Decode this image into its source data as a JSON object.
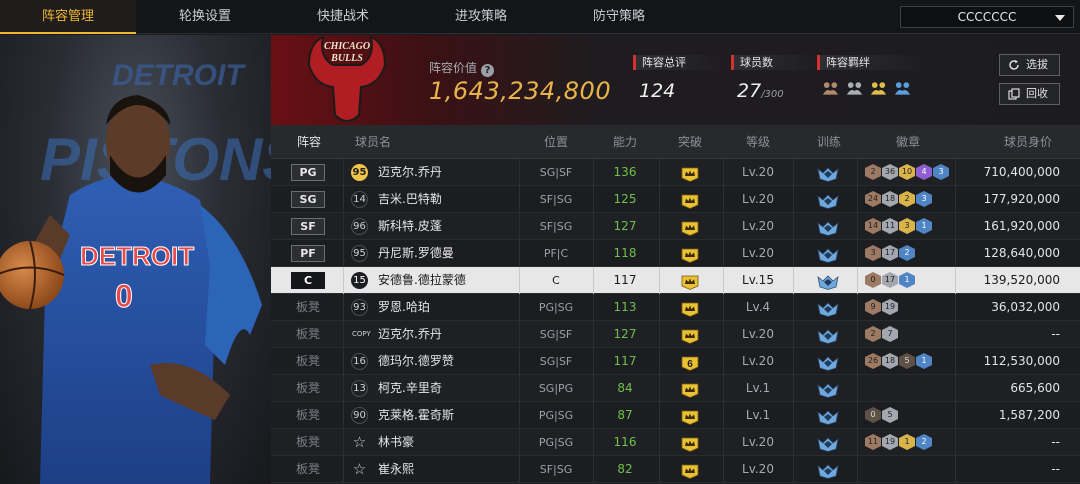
{
  "nav": {
    "tabs": [
      "阵容管理",
      "轮换设置",
      "快捷战术",
      "进攻策略",
      "防守策略"
    ],
    "team_select": "CCCCCCC"
  },
  "art": {
    "backdrop_lines": [
      "DETROIT",
      "PISTONS"
    ],
    "jersey_city": "DETROIT",
    "jersey_number": "0",
    "team_logo_lines": [
      "CHICAGO",
      "BULLS"
    ]
  },
  "header": {
    "value_label": "阵容价值",
    "help_icon": "?",
    "value": "1,643,234,800",
    "overall_label": "阵容总评",
    "overall": "124",
    "players_label": "球员数",
    "players": "27",
    "players_max": "/300",
    "chem_label": "阵容羁绊",
    "chem_icons": [
      "handshake-icon",
      "handshake-icon",
      "handshake-gold-icon",
      "handshake-blue-icon"
    ],
    "select_btn": "选拔",
    "recycle_btn": "回收"
  },
  "table": {
    "columns": [
      "阵容",
      "球员名",
      "位置",
      "能力",
      "突破",
      "等级",
      "训练",
      "徽章",
      "球员身价"
    ],
    "rows": [
      {
        "slot": "PG",
        "bench": false,
        "num": "95",
        "num_style": "gold",
        "name": "迈克尔.乔丹",
        "position": "SG|SF",
        "rating": "136",
        "breakthrough": "crown",
        "level": "Lv.20",
        "badges": [
          [
            "2",
            "bronze"
          ],
          [
            "36",
            "silver"
          ],
          [
            "10",
            "gold"
          ],
          [
            "4",
            "purple"
          ],
          [
            "3",
            "blue"
          ]
        ],
        "salary": "710,400,000"
      },
      {
        "slot": "SG",
        "bench": false,
        "num": "14",
        "num_style": "plain",
        "name": "吉米.巴特勒",
        "position": "SF|SG",
        "rating": "125",
        "breakthrough": "crown",
        "level": "Lv.20",
        "badges": [
          [
            "24",
            "bronze"
          ],
          [
            "18",
            "silver"
          ],
          [
            "2",
            "gold"
          ],
          [
            "3",
            "blue"
          ]
        ],
        "salary": "177,920,000"
      },
      {
        "slot": "SF",
        "bench": false,
        "num": "96",
        "num_style": "plain",
        "name": "斯科特.皮蓬",
        "position": "SF|SG",
        "rating": "127",
        "breakthrough": "crown",
        "level": "Lv.20",
        "badges": [
          [
            "14",
            "bronze"
          ],
          [
            "11",
            "silver"
          ],
          [
            "3",
            "gold"
          ],
          [
            "1",
            "blue"
          ]
        ],
        "salary": "161,920,000"
      },
      {
        "slot": "PF",
        "bench": false,
        "num": "95",
        "num_style": "plain",
        "name": "丹尼斯.罗德曼",
        "position": "PF|C",
        "rating": "118",
        "breakthrough": "crown",
        "level": "Lv.20",
        "badges": [
          [
            "3",
            "bronze"
          ],
          [
            "17",
            "silver"
          ],
          [
            "2",
            "blue"
          ]
        ],
        "salary": "128,640,000"
      },
      {
        "slot": "C",
        "bench": false,
        "selected": true,
        "num": "15",
        "num_style": "dark",
        "name": "安德鲁.德拉蒙德",
        "position": "C",
        "rating": "117",
        "breakthrough": "crown",
        "level": "Lv.15",
        "badges": [
          [
            "0",
            "bronze"
          ],
          [
            "17",
            "silver"
          ],
          [
            "1",
            "blue"
          ]
        ],
        "salary": "139,520,000"
      },
      {
        "slot": "板凳",
        "bench": true,
        "num": "93",
        "num_style": "plain",
        "name": "罗恩.哈珀",
        "position": "PG|SG",
        "rating": "113",
        "breakthrough": "crown",
        "level": "Lv.4",
        "badges": [
          [
            "9",
            "bronze"
          ],
          [
            "19",
            "silver"
          ]
        ],
        "salary": "36,032,000"
      },
      {
        "slot": "板凳",
        "bench": true,
        "num": "COPY",
        "num_style": "copy",
        "name": "迈克尔.乔丹",
        "position": "SG|SF",
        "rating": "127",
        "breakthrough": "crown",
        "level": "Lv.20",
        "badges": [
          [
            "2",
            "bronze"
          ],
          [
            "7",
            "silver"
          ]
        ],
        "salary": "--"
      },
      {
        "slot": "板凳",
        "bench": true,
        "num": "16",
        "num_style": "plain",
        "name": "德玛尔.德罗赞",
        "position": "SG|SF",
        "rating": "117",
        "breakthrough": "6",
        "level": "Lv.20",
        "badges": [
          [
            "26",
            "bronze"
          ],
          [
            "18",
            "silver"
          ],
          [
            "5",
            "dark"
          ],
          [
            "1",
            "blue"
          ]
        ],
        "salary": "112,530,000"
      },
      {
        "slot": "板凳",
        "bench": true,
        "num": "13",
        "num_style": "plain",
        "name": "柯克.辛里奇",
        "position": "SG|PG",
        "rating": "84",
        "breakthrough": "crown",
        "level": "Lv.1",
        "badges": [],
        "salary": "665,600"
      },
      {
        "slot": "板凳",
        "bench": true,
        "num": "90",
        "num_style": "plain",
        "name": "克莱格.霍奇斯",
        "position": "PG|SG",
        "rating": "87",
        "breakthrough": "crown",
        "level": "Lv.1",
        "badges": [
          [
            "0",
            "dark"
          ],
          [
            "5",
            "silver"
          ]
        ],
        "salary": "1,587,200"
      },
      {
        "slot": "板凳",
        "bench": true,
        "num": "☆",
        "num_style": "star",
        "name": "林书豪",
        "position": "PG|SG",
        "rating": "116",
        "breakthrough": "crown",
        "level": "Lv.20",
        "badges": [
          [
            "11",
            "bronze"
          ],
          [
            "19",
            "silver"
          ],
          [
            "1",
            "gold"
          ],
          [
            "2",
            "blue"
          ]
        ],
        "salary": "--"
      },
      {
        "slot": "板凳",
        "bench": true,
        "num": "☆",
        "num_style": "star",
        "name": "崔永熙",
        "position": "SF|SG",
        "rating": "82",
        "breakthrough": "crown",
        "level": "Lv.20",
        "badges": [],
        "salary": "--"
      }
    ]
  },
  "colors": {
    "accent_gold": "#f0b632",
    "rating_green": "#6ec04a",
    "value_gold": "#e8b44a",
    "label_red": "#d23232"
  }
}
